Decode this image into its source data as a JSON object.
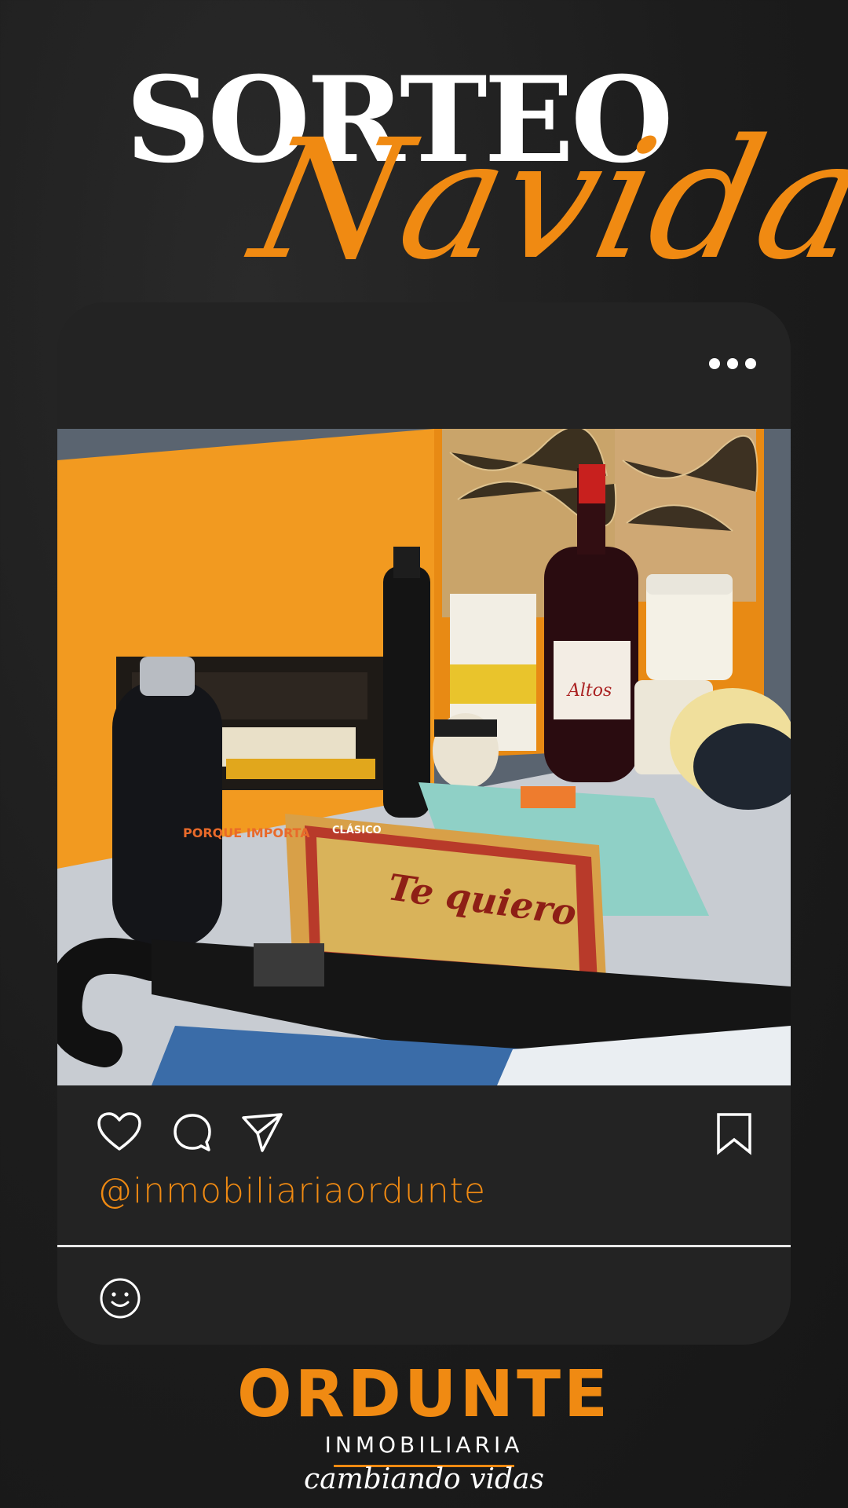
{
  "header": {
    "title": "SORTEO",
    "script_title": "Navidad"
  },
  "post": {
    "more_icon": "more-horizontal-icon",
    "image_alt": "Lote de Navidad",
    "product_labels": {
      "turron": "Te quiero",
      "bottle_text": "PORQUE IMPORTA",
      "wine_label": "Altos",
      "box_label": "CLÁSICO"
    },
    "actions": {
      "like_icon": "heart-icon",
      "comment_icon": "comment-icon",
      "share_icon": "send-icon",
      "save_icon": "bookmark-icon"
    },
    "handle": "@inmobiliariaordunte",
    "comment_icon": "smiley-icon"
  },
  "footer": {
    "brand": "ORDUNTE",
    "subtitle": "INMOBILIARIA",
    "tagline": "cambiando vidas"
  },
  "colors": {
    "accent": "#f08a12",
    "card": "#232323",
    "background": "#1c1c1c"
  }
}
